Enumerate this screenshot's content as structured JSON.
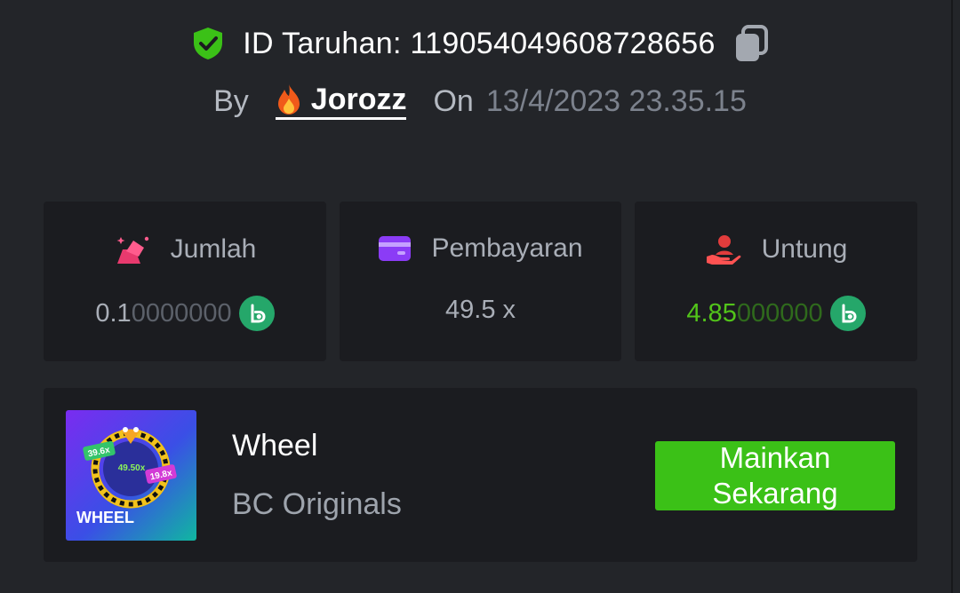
{
  "header": {
    "bet_id_label": "ID Taruhan: 119054049608728656",
    "by_label": "By",
    "user_name": "Jorozz",
    "on_label": "On",
    "date": "13/4/2023 23.35.15"
  },
  "stats": {
    "amount": {
      "label": "Jumlah",
      "value_main": "0.1",
      "value_dim": "0000000"
    },
    "payout": {
      "label": "Pembayaran",
      "value": "49.5 x"
    },
    "profit": {
      "label": "Untung",
      "value_main": "4.85",
      "value_dim": "000000"
    }
  },
  "game": {
    "name": "Wheel",
    "provider": "BC Originals",
    "play_label": "Mainkan Sekarang",
    "thumb_title": "WHEEL",
    "thumb_labels": [
      "39.6x",
      "49.50x",
      "19.8x"
    ]
  },
  "colors": {
    "background": "#232529",
    "card": "#1b1c20",
    "accent_green": "#3bc117",
    "profit_green": "#52c41a",
    "coin": "#25a76a",
    "shield": "#3bc117"
  },
  "icons": {
    "verified": "shield-check-icon",
    "copy": "copy-icon",
    "user_badge": "fire-icon",
    "amount": "bet-amount-icon",
    "payout": "card-icon",
    "profit": "hand-profit-icon",
    "coin": "bc-coin-icon"
  }
}
